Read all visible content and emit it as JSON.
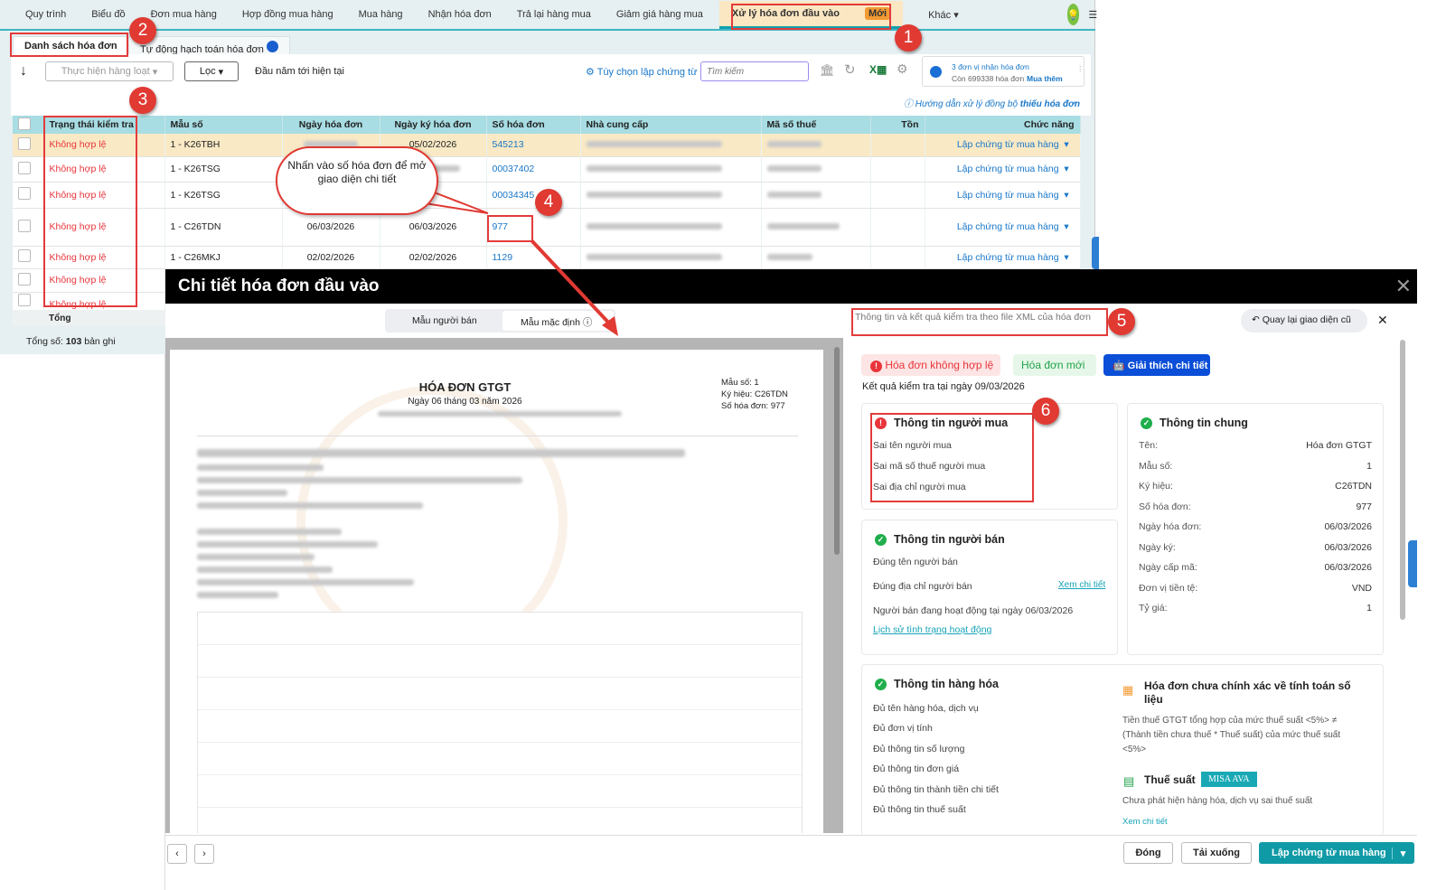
{
  "nav": {
    "items": [
      "Quy trình",
      "Biểu đồ",
      "Đơn mua hàng",
      "Hợp đồng mua hàng",
      "Mua hàng",
      "Nhận hóa đơn",
      "Trả lại hàng mua",
      "Giảm giá hàng mua"
    ],
    "active": "Xử lý hóa đơn đầu vào",
    "active_badge": "Mới",
    "more": "Khác"
  },
  "tabs": [
    "Danh sách hóa đơn",
    "Tự động hạch toán hóa đơn"
  ],
  "toolbar": {
    "bulk": "Thực hiện hàng loạt",
    "filter": "Lọc",
    "period": "Đầu năm tới hiện tại",
    "options": "Tùy chọn lập chứng từ",
    "search_placeholder": "Tìm kiếm",
    "promo_line1": "3 đơn vị nhận hóa đơn",
    "promo_line2": "Còn 699338 hóa đơn",
    "promo_buy": "Mua thêm",
    "guide": "Hướng dẫn xử lý đồng bộ",
    "guide_bold": "thiếu hóa đơn"
  },
  "table": {
    "headers": [
      "Trạng thái kiểm tra",
      "Mẫu số",
      "Ngày hóa đơn",
      "Ngày ký hóa đơn",
      "Số hóa đơn",
      "Nhà cung cấp",
      "Mã số thuế",
      "Tồn",
      "Chức năng"
    ],
    "rows": [
      {
        "status": "Không hợp lệ",
        "mau": "1 - K26TBH",
        "ngay": "",
        "ngayky": "05/02/2026",
        "so": "545213",
        "action": "Lập chứng từ mua hàng"
      },
      {
        "status": "Không hợp lệ",
        "mau": "1 - K26TSG",
        "ngay": "",
        "ngayky": "",
        "so": "00037402",
        "action": "Lập chứng từ mua hàng"
      },
      {
        "status": "Không hợp lệ",
        "mau": "1 - K26TSG",
        "ngay": "",
        "ngayky": "",
        "so": "00034345",
        "action": "Lập chứng từ mua hàng"
      },
      {
        "status": "Không hợp lệ",
        "mau": "1 - C26TDN",
        "ngay": "06/03/2026",
        "ngayky": "06/03/2026",
        "so": "977",
        "action": "Lập chứng từ mua hàng"
      },
      {
        "status": "Không hợp lệ",
        "mau": "1 - C26MKJ",
        "ngay": "02/02/2026",
        "ngayky": "02/02/2026",
        "so": "1129",
        "action": "Lập chứng từ mua hàng"
      },
      {
        "status": "Không hợp lệ"
      },
      {
        "status": "Không hợp lệ"
      }
    ],
    "total_label": "Tổng",
    "count_prefix": "Tổng số:",
    "count": "103",
    "count_suffix": "bản ghi"
  },
  "callout": "Nhấn vào số hóa đơn để mở giao diện chi tiết",
  "annotations": [
    "1",
    "2",
    "3",
    "4",
    "5",
    "6"
  ],
  "modal": {
    "title": "Chi tiết hóa đơn đầu vào",
    "view_seller": "Mẫu người bán",
    "view_default": "Mẫu mặc định",
    "xml_info": "Thông tin và kết quả kiểm tra theo file XML của hóa đơn",
    "back_old": "Quay lại giao diện cũ",
    "invoice": {
      "title": "HÓA ĐƠN GTGT",
      "date": "Ngày 06 tháng 03 năm 2026",
      "mau": "Mẫu số:  1",
      "kyhieu": "Ký hiệu:  C26TDN",
      "so": "Số hóa đơn:  977"
    },
    "badge_invalid": "Hóa đơn không hợp lệ",
    "badge_new": "Hóa đơn mới",
    "explain": "Giải thích chi tiết",
    "checked_at": "Kết quả kiểm tra tại ngày 09/03/2026",
    "buyer": {
      "title": "Thông tin người mua",
      "errors": [
        "Sai tên người mua",
        "Sai mã số thuế người mua",
        "Sai địa chỉ người mua"
      ]
    },
    "seller": {
      "title": "Thông tin người bán",
      "name_ok": "Đúng tên người bán",
      "addr_ok": "Đúng địa chỉ người bán",
      "detail": "Xem chi tiết",
      "active": "Người bán đang hoạt động tại ngày 06/03/2026",
      "history": "Lịch sử tình trạng hoạt động"
    },
    "general": {
      "title": "Thông tin chung",
      "rows": [
        [
          "Tên:",
          "Hóa đơn GTGT"
        ],
        [
          "Mẫu số:",
          "1"
        ],
        [
          "Ký hiệu:",
          "C26TDN"
        ],
        [
          "Số hóa đơn:",
          "977"
        ],
        [
          "Ngày hóa đơn:",
          "06/03/2026"
        ],
        [
          "Ngày ký:",
          "06/03/2026"
        ],
        [
          "Ngày cấp mã:",
          "06/03/2026"
        ],
        [
          "Đơn vị tiền tệ:",
          "VND"
        ],
        [
          "Tỷ giá:",
          "1"
        ]
      ]
    },
    "goods": {
      "title": "Thông tin hàng hóa",
      "items": [
        "Đủ tên hàng hóa, dịch vụ",
        "Đủ đơn vị tính",
        "Đủ thông tin số lượng",
        "Đủ thông tin đơn giá",
        "Đủ thông tin thành tiền chi tiết",
        "Đủ thông tin thuế suất"
      ]
    },
    "calc": {
      "title": "Hóa đơn chưa chính xác về tính toán số liệu",
      "desc": "Tiền thuế GTGT tổng hợp của mức thuế suất <5%> ≠ (Thành tiền chưa thuế * Thuế suất) của mức thuế suất <5%>"
    },
    "tax": {
      "title": "Thuế suất",
      "ava": "MISA AVA",
      "desc": "Chưa phát hiện hàng hóa, dịch vụ sai thuế suất",
      "detail": "Xem chi tiết"
    },
    "footer": {
      "close": "Đóng",
      "download": "Tải xuống",
      "create": "Lập chứng từ mua hàng"
    }
  },
  "colors": {
    "accent": "#109aa6",
    "error": "#e8353b",
    "link": "#1877c9",
    "annotation": "#e03a33"
  }
}
